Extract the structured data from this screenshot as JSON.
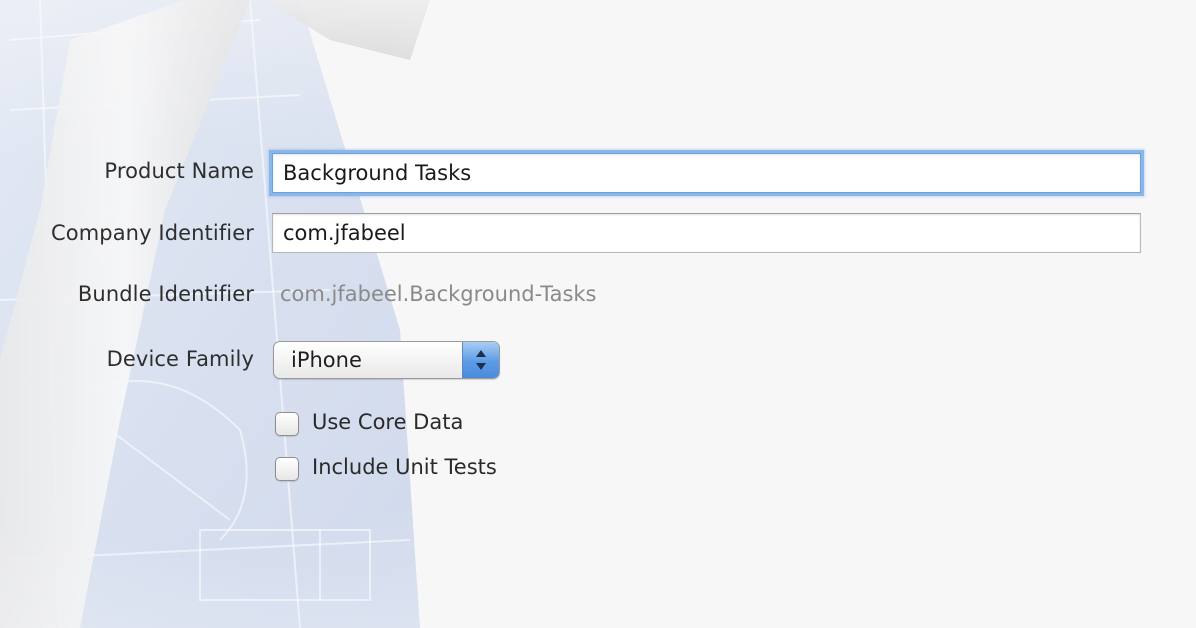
{
  "form": {
    "product_name": {
      "label": "Product Name",
      "value": "Background Tasks"
    },
    "company_identifier": {
      "label": "Company Identifier",
      "value": "com.jfabeel"
    },
    "bundle_identifier": {
      "label": "Bundle Identifier",
      "value": "com.jfabeel.Background-Tasks"
    },
    "device_family": {
      "label": "Device Family",
      "selected": "iPhone"
    },
    "use_core_data": {
      "label": "Use Core Data",
      "checked": false
    },
    "include_unit_tests": {
      "label": "Include Unit Tests",
      "checked": false
    }
  },
  "icons": {
    "background": "xcode-hammer-blueprint-icon",
    "stepper": "up-down-arrows-icon",
    "checkbox": "checkbox-icon"
  },
  "colors": {
    "focus_ring": "#8ab7ea",
    "stepper_blue": "#5c9be4",
    "label_text": "#2e2e2e",
    "muted_text": "#8a8a8a"
  }
}
